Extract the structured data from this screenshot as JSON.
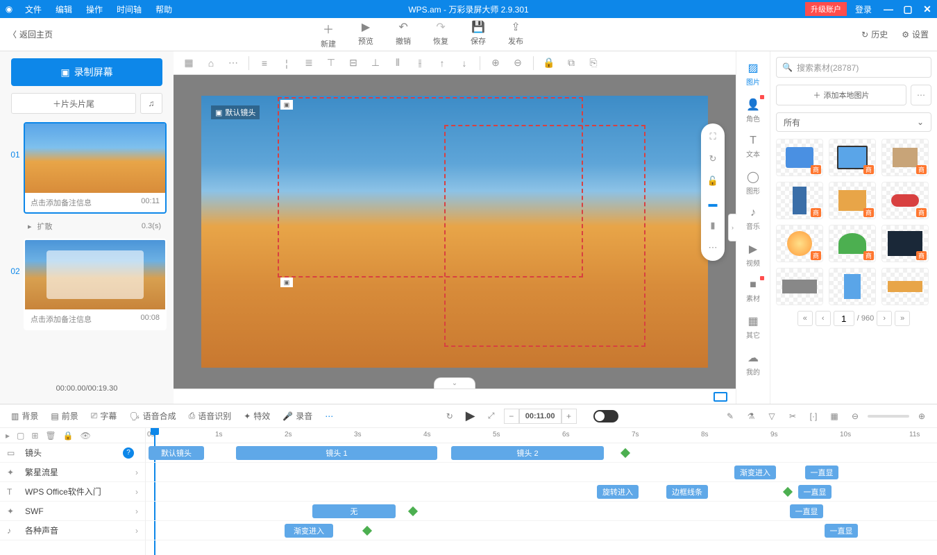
{
  "titleBar": {
    "menus": [
      "文件",
      "编辑",
      "操作",
      "时间轴",
      "帮助"
    ],
    "title": "WPS.am - 万彩录屏大师 2.9.301",
    "upgrade": "升级账户",
    "login": "登录"
  },
  "mainToolbar": {
    "back": "返回主页",
    "tools": [
      {
        "icon": "＋",
        "label": "新建"
      },
      {
        "icon": "▶",
        "label": "预览"
      },
      {
        "icon": "↶",
        "label": "撤销"
      },
      {
        "icon": "↷",
        "label": "恢复"
      },
      {
        "icon": "💾",
        "label": "保存"
      },
      {
        "icon": "⇪",
        "label": "发布"
      }
    ],
    "history": "历史",
    "settings": "设置"
  },
  "leftPanel": {
    "record": "录制屏幕",
    "headTail": "片头片尾",
    "slide1": {
      "caption": "点击添加备注信息",
      "time": "00:11"
    },
    "transition": {
      "name": "扩散",
      "duration": "0.3(s)"
    },
    "slide2": {
      "caption": "点击添加备注信息",
      "time": "00:08"
    },
    "timestamp": "00:00.00/00:19.30"
  },
  "canvas": {
    "camLabel": "默认镜头"
  },
  "assetTabs": [
    "图片",
    "角色",
    "文本",
    "图形",
    "音乐",
    "视频",
    "素材",
    "其它",
    "我的"
  ],
  "assetPanel": {
    "searchPlaceholder": "搜索素材(28787)",
    "addLocal": "添加本地图片",
    "filter": "所有",
    "badge": "商",
    "page": "1",
    "totalPages": "/ 960"
  },
  "timeline": {
    "toolbar": [
      "背景",
      "前景",
      "字幕",
      "语音合成",
      "语音识别",
      "特效",
      "录音"
    ],
    "time": "00:11.00",
    "ticks": [
      "0s",
      "1s",
      "2s",
      "3s",
      "4s",
      "5s",
      "6s",
      "7s",
      "8s",
      "9s",
      "10s",
      "11s"
    ],
    "tracks": [
      {
        "icon": "▭",
        "name": "镜头"
      },
      {
        "icon": "✦",
        "name": "繁星流星"
      },
      {
        "icon": "T",
        "name": "WPS Office软件入门"
      },
      {
        "icon": "✦",
        "name": "SWF"
      },
      {
        "icon": "♪",
        "name": "各种声音"
      }
    ],
    "clips": {
      "defaultCam": "默认镜头",
      "cam1": "镜头 1",
      "cam2": "镜头 2",
      "fadeIn": "渐变进入",
      "alwaysShow": "一直显",
      "rotateIn": "旋转进入",
      "borderLine": "边框线条",
      "none": "无"
    }
  }
}
